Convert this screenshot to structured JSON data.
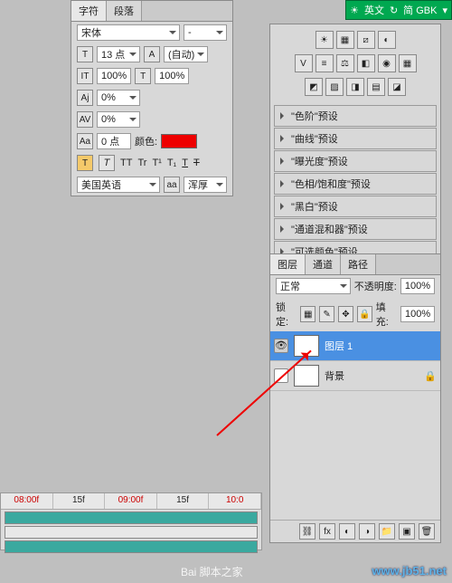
{
  "ime": {
    "lang": "英文",
    "mode": "简 GBK"
  },
  "char_panel": {
    "tabs": [
      "字符",
      "段落"
    ],
    "font": "宋体",
    "style": "-",
    "size": "13 点",
    "leading": "(自动)",
    "tracking": "100%",
    "kerning": "100%",
    "va": "0%",
    "baseline": "0%",
    "shift": "0 点",
    "color_label": "颜色:",
    "lang": "美国英语",
    "aa": "浑厚"
  },
  "adjust": {
    "presets": [
      "\"色阶\"预设",
      "\"曲线\"预设",
      "\"曝光度\"预设",
      "\"色相/饱和度\"预设",
      "\"黑白\"预设",
      "\"通道混和器\"预设",
      "\"可选颜色\"预设"
    ]
  },
  "layers": {
    "tabs": [
      "图层",
      "通道",
      "路径"
    ],
    "blend": "正常",
    "opacity_label": "不透明度:",
    "opacity": "100%",
    "lock_label": "锁定:",
    "fill_label": "填充:",
    "fill": "100%",
    "items": [
      {
        "name": "图层 1"
      },
      {
        "name": "背景"
      }
    ]
  },
  "timeline": {
    "marks": [
      "08:00f",
      "15f",
      "09:00f",
      "15f",
      "10:0"
    ]
  },
  "watermark": "www.jb51.net",
  "wm2": "Bai 脚本之家"
}
